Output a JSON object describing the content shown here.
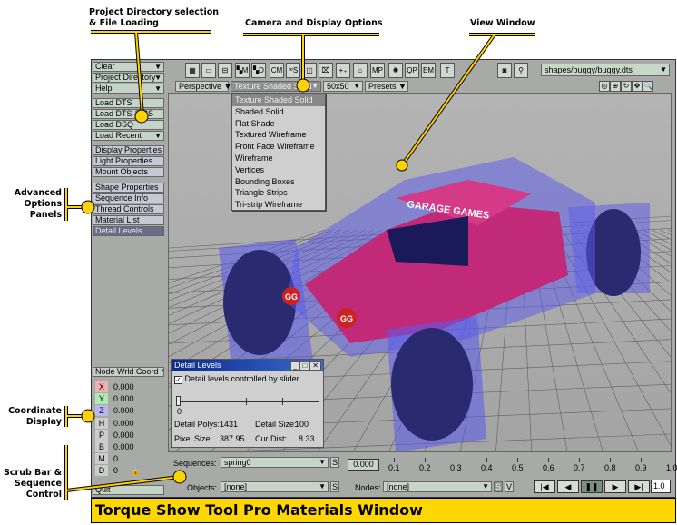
{
  "annotations": {
    "project": "Project Directory selection",
    "project2": "& File Loading",
    "camera": "Camera and Display Options",
    "view": "View Window",
    "advanced": [
      "Advanced",
      "Options",
      "Panels"
    ],
    "coordinate": [
      "Coordinate",
      "Display"
    ],
    "scrub": [
      "Scrub Bar &",
      "Sequence",
      "Control"
    ]
  },
  "sidebar": {
    "top": [
      {
        "label": "Clear",
        "dd": "▼"
      },
      {
        "label": "Project Directory",
        "dd": "▼"
      },
      {
        "label": "Help",
        "dd": "▼"
      }
    ],
    "load": [
      {
        "label": "Load DTS"
      },
      {
        "label": "Load DTS & CS"
      },
      {
        "label": "Load DSQ"
      },
      {
        "label": "Load Recent",
        "dd": "▼"
      }
    ],
    "props": [
      "Display Properties",
      "Light Properties",
      "Mount Objects"
    ],
    "panels": [
      "Shape Properties",
      "Sequence Info",
      "Thread Controls",
      "Material List",
      "Detail Levels"
    ],
    "coord_mode": "Node Wrld Coord ▼",
    "coords": [
      {
        "k": "X",
        "v": "0.000",
        "c": "#f0b0b0"
      },
      {
        "k": "Y",
        "v": "0.000",
        "c": "#b0e8b0"
      },
      {
        "k": "Z",
        "v": "0.000",
        "c": "#b8b8f0"
      },
      {
        "k": "H",
        "v": "0.000"
      },
      {
        "k": "P",
        "v": "0.000"
      },
      {
        "k": "B",
        "v": "0.000"
      },
      {
        "k": "M",
        "v": "0"
      },
      {
        "k": "D",
        "v": "0"
      }
    ],
    "quit": "Quit"
  },
  "toolbar": {
    "icons": [
      "▦",
      "▭",
      "⊟",
      "▚M",
      "▚D",
      "CM",
      "ꟹS",
      "◫",
      "⌧",
      "+₊",
      "⌂",
      "MP",
      "✺",
      "QP",
      "EM",
      "T"
    ],
    "right_icons": [
      "◙",
      "⚲"
    ],
    "file": "shapes/buggy/buggy.dts",
    "camera": "Perspective ▼",
    "render_mode": "Texture Shaded Solid",
    "grid": "50x50",
    "presets": "Presets ▼",
    "view_icons": [
      "◎",
      "⊕",
      "↻",
      "✥",
      "🔍"
    ]
  },
  "render_menu": [
    "Texture Shaded Solid",
    "Shaded Solid",
    "Flat Shade",
    "Textured Wireframe",
    "Front Face Wireframe",
    "Wireframe",
    "Vertices",
    "Bounding Boxes",
    "Triangle Strips",
    "Tri-strip Wireframe"
  ],
  "viewport": {
    "banner": "GARAGE GAMES",
    "badge": "GG"
  },
  "detail": {
    "title": "Detail Levels",
    "checkbox": "Detail levels controlled by slider",
    "checked": true,
    "slider_value": "0",
    "polys_label": "Detail Polys:",
    "polys": "1431",
    "size_label": "Detail Size:",
    "size": "100",
    "pixel_label": "Pixel Size:",
    "pixel": "387.95",
    "dist_label": "Cur Dist:",
    "dist": "8.33"
  },
  "bottom": {
    "seq_label": "Sequences:",
    "seq": "spring0",
    "s": "S",
    "v": "V",
    "obj_label": "Objects:",
    "obj": "[none]",
    "nodes_label": "Nodes:",
    "nodes": "[none]",
    "time": "0.000",
    "ticks": [
      "0.1",
      "0.2",
      "0.3",
      "0.4",
      "0.5",
      "0.6",
      "0.7",
      "0.8",
      "0.9",
      "1.0"
    ],
    "speed": "1.0"
  },
  "caption": "Torque Show Tool Pro Materials Window"
}
